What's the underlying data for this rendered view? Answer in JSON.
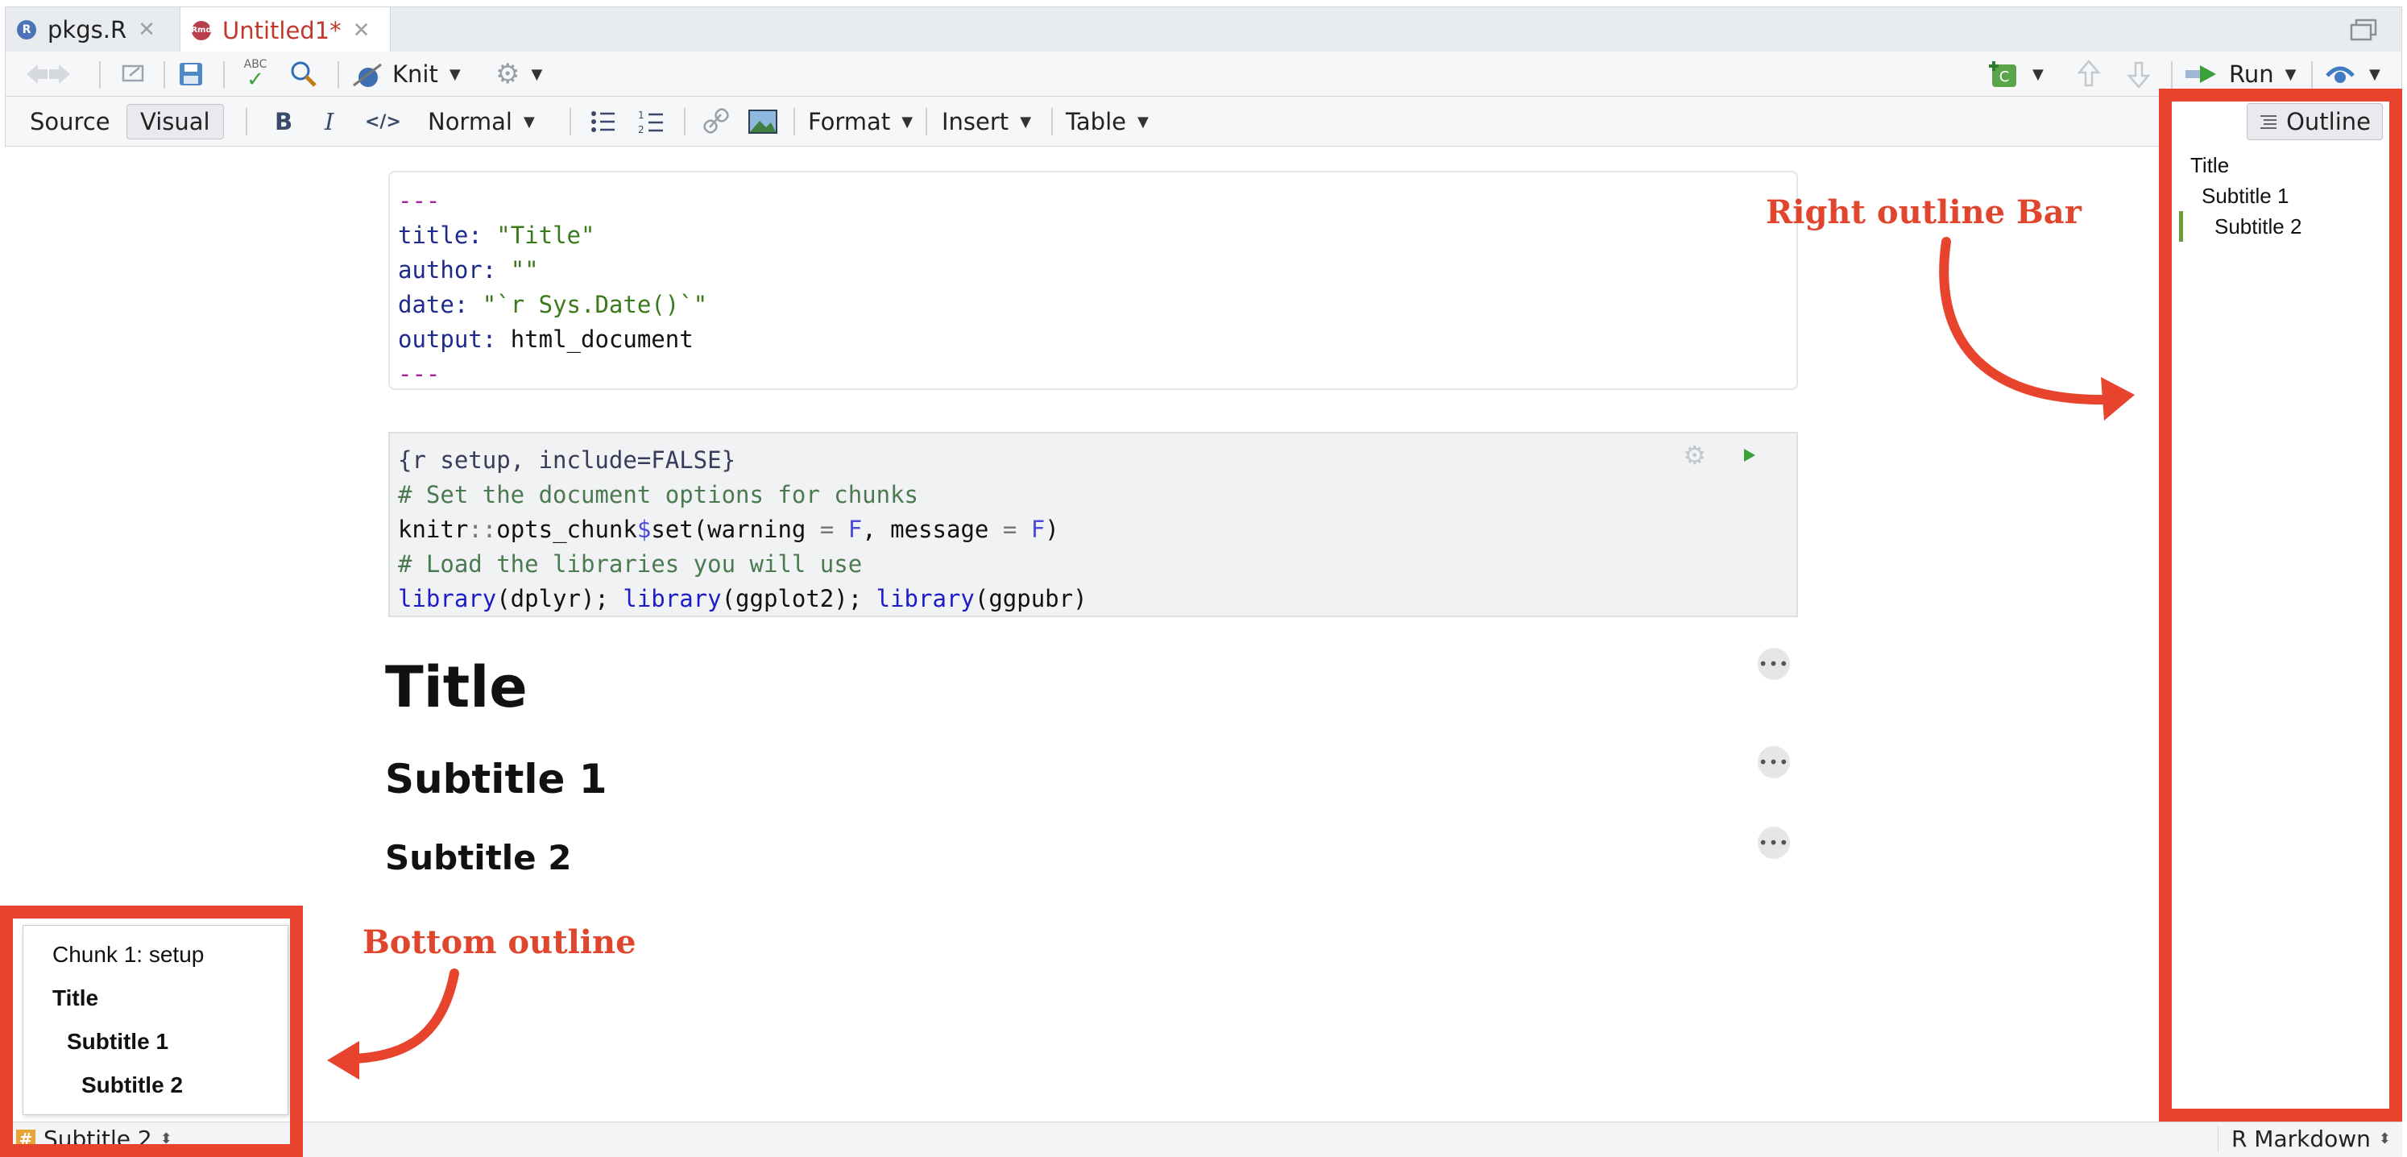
{
  "tabs": [
    {
      "label": "pkgs.R",
      "icon": "r-file-icon",
      "active": false
    },
    {
      "label": "Untitled1*",
      "icon": "rmd-file-icon",
      "active": true
    }
  ],
  "toolbar1": {
    "knit_label": "Knit",
    "run_label": "Run",
    "spell_label": "ABC"
  },
  "toolbar2": {
    "source_label": "Source",
    "visual_label": "Visual",
    "bold_label": "B",
    "italic_label": "I",
    "code_label": "</>",
    "style_select": "Normal",
    "format_label": "Format",
    "insert_label": "Insert",
    "table_label": "Table",
    "outline_label": "Outline"
  },
  "yaml": {
    "dash_open": "---",
    "title_key": "title:",
    "title_val": "\"Title\"",
    "author_key": "author:",
    "author_val": "\"\"",
    "date_key": "date:",
    "date_val": "\"`r Sys.Date()`\"",
    "output_key": "output:",
    "output_val": "html_document",
    "dash_close": "---"
  },
  "chunk": {
    "header": "{r setup, include=FALSE}",
    "comment1": "# Set the document options for chunks",
    "line2_a": "knitr",
    "line2_b": "::",
    "line2_c": "opts_chunk",
    "line2_d": "$",
    "line2_e": "set",
    "line2_f": "(warning ",
    "line2_g": "=",
    "line2_h": " F",
    "line2_i": ", message ",
    "line2_j": "=",
    "line2_k": " F",
    "line2_l": ")",
    "comment2": "# Load the libraries you will use",
    "lib1_fn": "library",
    "lib1_arg": "(dplyr); ",
    "lib2_fn": "library",
    "lib2_arg": "(ggplot2); ",
    "lib3_fn": "library",
    "lib3_arg": "(ggpubr)"
  },
  "headings": {
    "title": "Title",
    "subtitle1": "Subtitle 1",
    "subtitle2": "Subtitle 2"
  },
  "right_outline": {
    "items": [
      "Title",
      "Subtitle 1",
      "Subtitle 2"
    ],
    "active_item": "Subtitle 2"
  },
  "bottom_outline": {
    "items": [
      "Chunk 1: setup",
      "Title",
      "Subtitle 1",
      "Subtitle 2"
    ]
  },
  "statusbar": {
    "current_section": "Subtitle 2",
    "doc_type": "R Markdown"
  },
  "annotations": {
    "right_label": "Right outline Bar",
    "bottom_label": "Bottom outline",
    "color": "#e8432d"
  },
  "colors": {
    "active_tab_text": "#c0392b",
    "outline_active_bar": "#6f9a3a"
  }
}
